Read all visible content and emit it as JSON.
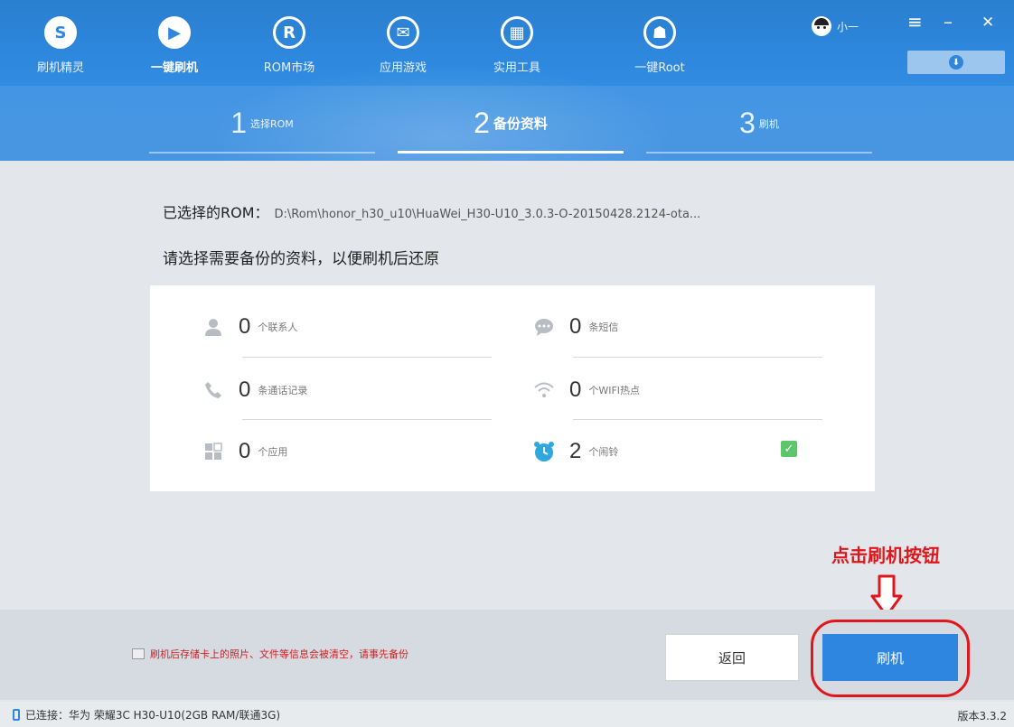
{
  "nav": {
    "items": [
      {
        "label": "刷机精灵",
        "icon": "S"
      },
      {
        "label": "一键刷机",
        "icon": "▶"
      },
      {
        "label": "ROM市场",
        "icon": "R"
      },
      {
        "label": "应用游戏",
        "icon": "✉"
      },
      {
        "label": "实用工具",
        "icon": "▦"
      },
      {
        "label": "一键Root",
        "icon": "☗"
      }
    ]
  },
  "user": {
    "name": "小一"
  },
  "window": {
    "menu": "≡",
    "minimize": "–",
    "close": "✕"
  },
  "download": {
    "icon": "⬇"
  },
  "steps": [
    {
      "num": "1",
      "label": "选择ROM"
    },
    {
      "num": "2",
      "label": "备份资料"
    },
    {
      "num": "3",
      "label": "刷机"
    }
  ],
  "rom": {
    "label": "已选择的ROM：",
    "path": "D:\\Rom\\honor_h30_u10\\HuaWei_H30-U10_3.0.3-O-20150428.2124-ota..."
  },
  "instruction": "请选择需要备份的资料，以便刷机后还原",
  "backup_items": [
    {
      "icon": "person-icon",
      "glyph": "👤",
      "count": "0",
      "label": "个联系人"
    },
    {
      "icon": "chat-icon",
      "glyph": "💬",
      "count": "0",
      "label": "条短信"
    },
    {
      "icon": "phone-icon",
      "glyph": "✆",
      "count": "0",
      "label": "条通话记录"
    },
    {
      "icon": "wifi-icon",
      "glyph": "◠",
      "count": "0",
      "label": "个WIFI热点"
    },
    {
      "icon": "apps-icon",
      "glyph": "▦",
      "count": "0",
      "label": "个应用"
    },
    {
      "icon": "alarm-icon",
      "glyph": "⏰",
      "count": "2",
      "label": "个闹铃"
    }
  ],
  "alarm_checked": true,
  "annotation": "点击刷机按钮",
  "warning": "刷机后存储卡上的照片、文件等信息会被清空，请事先备份",
  "buttons": {
    "back": "返回",
    "flash": "刷机"
  },
  "status": {
    "connected": "已连接：华为 荣耀3C H30-U10(2GB RAM/联通3G)",
    "version": "版本3.3.2"
  },
  "colors": {
    "brand": "#2f86e0",
    "annotation": "#e0161b",
    "check": "#5cc66a"
  }
}
